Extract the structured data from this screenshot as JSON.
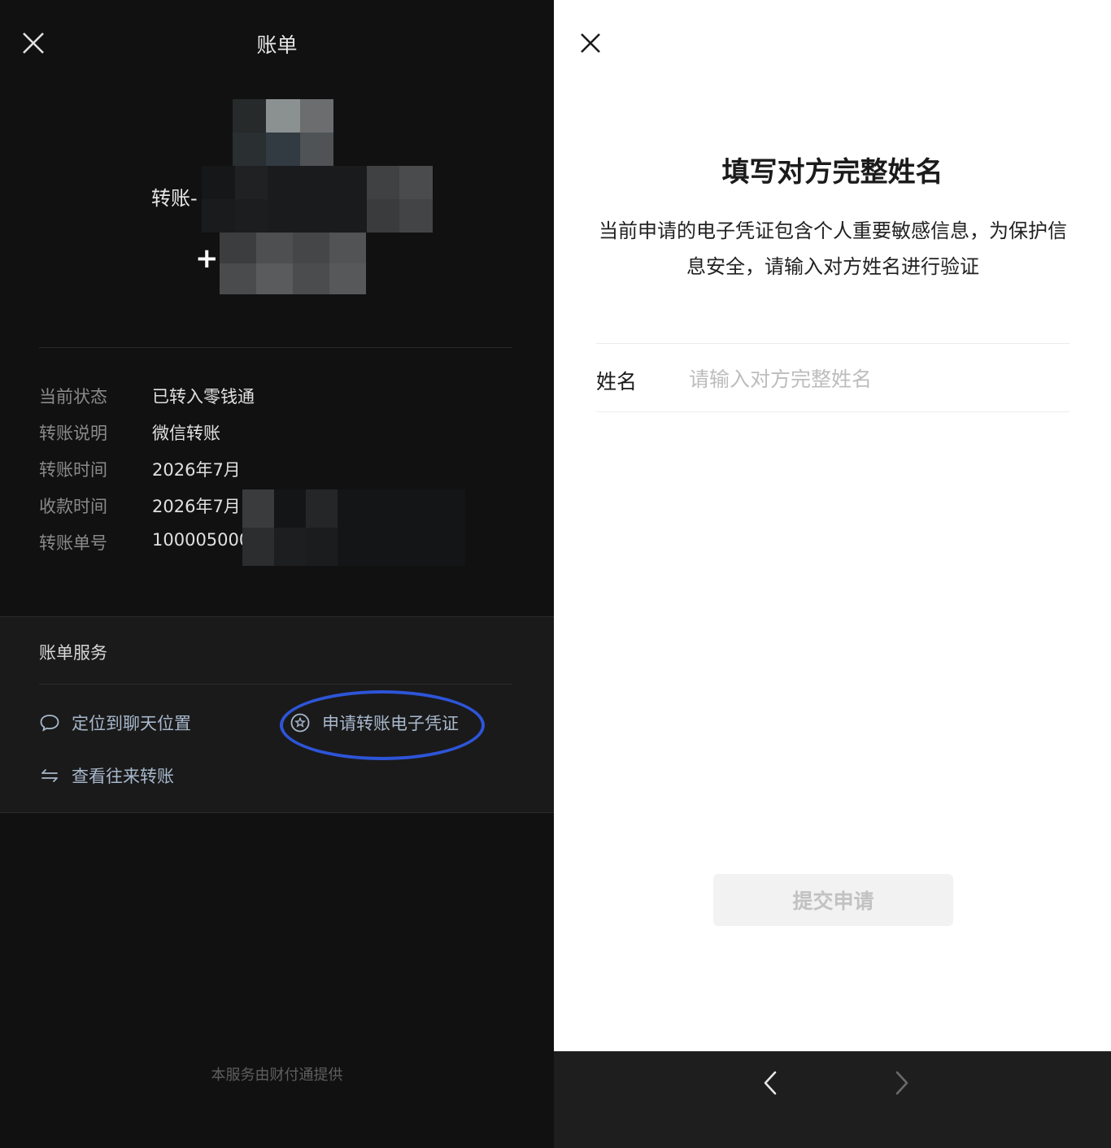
{
  "bill": {
    "title": "账单",
    "payee": "转账-",
    "amount_sign": "+",
    "details": [
      {
        "label": "当前状态",
        "value": "已转入零钱通"
      },
      {
        "label": "转账说明",
        "value": "微信转账"
      },
      {
        "label": "转账时间",
        "value": "2026年7月"
      },
      {
        "label": "收款时间",
        "value": "2026年7月"
      },
      {
        "label": "转账单号",
        "value": "100005000"
      }
    ],
    "services_heading": "账单服务",
    "services": {
      "locate_chat": "定位到聊天位置",
      "apply_voucher": "申请转账电子凭证",
      "view_transfers": "查看往来转账"
    },
    "footer": "本服务由财付通提供"
  },
  "verify": {
    "title": "填写对方完整姓名",
    "description": "当前申请的电子凭证包含个人重要敏感信息，为保护信息安全，请输入对方姓名进行验证",
    "name_label": "姓名",
    "name_placeholder": "请输入对方完整姓名",
    "name_value": "",
    "submit_label": "提交申请"
  },
  "colors": {
    "highlight_ring": "#2d55d8",
    "link": "#a8b8cc"
  }
}
